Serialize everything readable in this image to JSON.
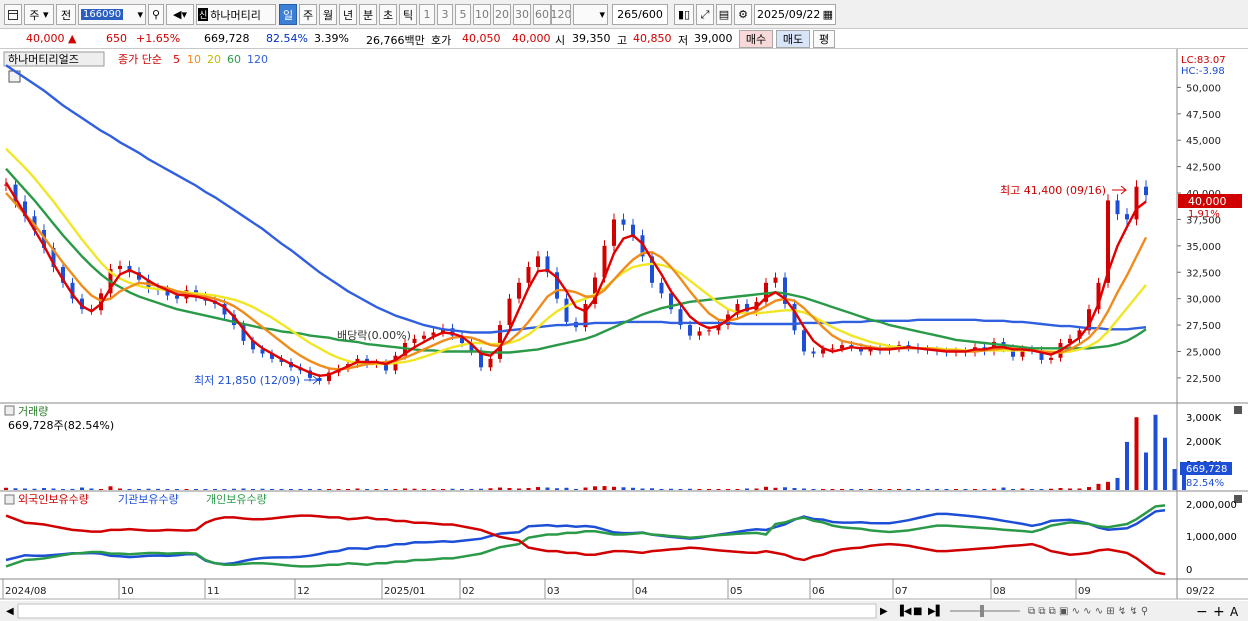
{
  "toolbar": {
    "period": "주",
    "prev": "전",
    "code": "166090",
    "stock_name": "하나머티리",
    "tf_day": "일",
    "tf_week": "주",
    "tf_month": "월",
    "tf_year": "년",
    "tf_minute": "분",
    "tf_second": "초",
    "tf_tick": "틱",
    "intervals": [
      "1",
      "3",
      "5",
      "10",
      "20",
      "30",
      "60",
      "120"
    ],
    "count": "265",
    "count_max": "/600",
    "date": "2025/09/22"
  },
  "quote": {
    "price": "40,000",
    "change": "650",
    "change_pct": "+1.65%",
    "volume": "669,728",
    "vol_ratio": "82.54%",
    "turnover": "3.39%",
    "amount": "26,766백만",
    "hoga_label": "호가",
    "ask": "40,050",
    "bid": "40,000",
    "open_label": "시",
    "open": "39,350",
    "high_label": "고",
    "high": "40,850",
    "low_label": "저",
    "low": "39,000",
    "buy": "매수",
    "sell": "매도",
    "avg": "평"
  },
  "legend": {
    "name": "하나머티리얼즈",
    "ma_label": "종가 단순",
    "periods": [
      "5",
      "10",
      "20",
      "60",
      "120"
    ]
  },
  "annotations": {
    "high": "최고 41,400 (09/16)",
    "low": "최저 21,850 (12/09)",
    "dividend": "배당락(0.00%)",
    "lc": "LC:83.07",
    "hc": "HC:-3.98",
    "cur_price": "40,000",
    "cur_pct": "1.91%"
  },
  "volume_panel": {
    "title": "거래량",
    "value_label": "669,728주(82.54%)",
    "cur": "669,728",
    "pct": "82.54%",
    "ticks": [
      "3,000K",
      "2,000K",
      "1,000K"
    ]
  },
  "holding_panel": {
    "foreign": "외국인보유수량",
    "institution": "기관보유수량",
    "individual": "개인보유수량",
    "ticks": [
      "2,000,000",
      "1,000,000",
      "0"
    ]
  },
  "colors": {
    "up": "#d00000",
    "down": "#1c4fd6",
    "ma5": "#e00000",
    "ma10": "#f08c1c",
    "ma20": "#f0e626",
    "ma60": "#2a9a48",
    "ma120": "#3060e0"
  },
  "chart_data": {
    "type": "candlestick",
    "x": [
      "2024/08",
      "10",
      "11",
      "12",
      "2025/01",
      "02",
      "03",
      "04",
      "05",
      "06",
      "07",
      "08",
      "09",
      "09/22"
    ],
    "y_ticks": [
      50000,
      47500,
      45000,
      42500,
      40000,
      37500,
      35000,
      32500,
      30000,
      27500,
      25000,
      22500
    ],
    "ylim": [
      20500,
      52500
    ],
    "close": [
      40800,
      39200,
      37800,
      36500,
      34800,
      33000,
      31500,
      30000,
      29000,
      28900,
      30500,
      32800,
      33100,
      32500,
      31800,
      31000,
      30800,
      30300,
      30000,
      30800,
      30200,
      29800,
      29500,
      28500,
      27500,
      26000,
      25200,
      24800,
      24300,
      24000,
      23500,
      23200,
      22500,
      22200,
      23000,
      23400,
      23800,
      24300,
      23800,
      23900,
      23200,
      24600,
      25800,
      26200,
      26500,
      26800,
      27200,
      26500,
      25800,
      25000,
      23500,
      24300,
      27500,
      30000,
      31500,
      33000,
      34000,
      32500,
      30000,
      27800,
      27300,
      29500,
      32000,
      35000,
      37500,
      37000,
      36000,
      34000,
      31500,
      30500,
      29000,
      27500,
      26500,
      26900,
      27000,
      27500,
      28500,
      29500,
      28800,
      29700,
      31500,
      32000,
      29500,
      27000,
      25000,
      24800,
      25200,
      25300,
      25600,
      25400,
      25000,
      25200,
      25100,
      25300,
      25600,
      25400,
      25200,
      25100,
      25000,
      24900,
      25000,
      24900,
      25400,
      25000,
      25900,
      25300,
      24500,
      25200,
      25100,
      24200,
      24400,
      25800,
      26200,
      27000,
      29000,
      31500,
      39300,
      38000,
      37500,
      40600,
      39800
    ],
    "ma5": [
      41000,
      39500,
      38000,
      36500,
      35000,
      33300,
      31800,
      30400,
      29300,
      28800,
      29500,
      31000,
      32300,
      32700,
      32300,
      31700,
      31200,
      30800,
      30400,
      30300,
      30200,
      30000,
      29700,
      29200,
      28300,
      27100,
      26000,
      25300,
      24800,
      24300,
      23800,
      23400,
      23000,
      22700,
      22800,
      23200,
      23600,
      24000,
      24000,
      24000,
      23800,
      24200,
      24800,
      25400,
      25900,
      26400,
      26800,
      26700,
      26400,
      25700,
      24800,
      24600,
      25400,
      27000,
      29000,
      31000,
      32600,
      32700,
      32000,
      30700,
      29200,
      28800,
      30000,
      32000,
      34300,
      35700,
      36000,
      35200,
      33700,
      32300,
      30700,
      29500,
      28300,
      27600,
      27200,
      27400,
      28000,
      28700,
      29000,
      29200,
      30100,
      30600,
      30000,
      28800,
      27300,
      26000,
      25300,
      25000,
      25200,
      25400,
      25300,
      25300,
      25200,
      25200,
      25300,
      25400,
      25300,
      25200,
      25100,
      25000,
      25000,
      25000,
      25200,
      25200,
      25400,
      25400,
      25200,
      25200,
      25100,
      24900,
      24700,
      25100,
      25700,
      26300,
      27500,
      29500,
      32500,
      35000,
      36800,
      38500,
      39200
    ],
    "ma10": [
      40000,
      39000,
      38000,
      37000,
      35800,
      34600,
      33400,
      32300,
      31200,
      30300,
      29800,
      30000,
      30700,
      31100,
      31500,
      31400,
      31200,
      31000,
      30700,
      30500,
      30300,
      30200,
      30000,
      29700,
      29300,
      28700,
      28000,
      27300,
      26600,
      25900,
      25200,
      24600,
      24100,
      23700,
      23400,
      23300,
      23400,
      23600,
      23800,
      23900,
      24000,
      24100,
      24400,
      24800,
      25200,
      25600,
      26000,
      26300,
      26400,
      26300,
      26000,
      25600,
      25500,
      26000,
      26800,
      27800,
      29000,
      30200,
      30800,
      30800,
      30600,
      30200,
      30200,
      30800,
      31800,
      32800,
      33700,
      34300,
      34400,
      33900,
      33000,
      31900,
      30700,
      29600,
      28600,
      28000,
      27900,
      28100,
      28500,
      28800,
      29300,
      29800,
      30000,
      29800,
      29100,
      28200,
      27300,
      26500,
      26000,
      25800,
      25600,
      25400,
      25300,
      25300,
      25300,
      25300,
      25300,
      25300,
      25200,
      25100,
      25100,
      25000,
      25000,
      25100,
      25200,
      25300,
      25300,
      25200,
      25100,
      25000,
      24900,
      24900,
      25200,
      25700,
      26300,
      27300,
      28800,
      30600,
      32200,
      34000,
      35800
    ],
    "ma20": [
      44200,
      43300,
      42400,
      41400,
      40300,
      39200,
      38000,
      36800,
      35600,
      34500,
      33400,
      32500,
      31900,
      31500,
      31200,
      31000,
      30900,
      30800,
      30700,
      30600,
      30500,
      30400,
      30300,
      30100,
      29900,
      29600,
      29200,
      28700,
      28200,
      27600,
      27000,
      26400,
      25800,
      25300,
      24800,
      24400,
      24100,
      23900,
      23800,
      23800,
      23800,
      23900,
      24000,
      24200,
      24500,
      24800,
      25100,
      25400,
      25600,
      25800,
      25800,
      25700,
      25700,
      25800,
      26100,
      26600,
      27300,
      28100,
      28800,
      29300,
      29700,
      30000,
      30400,
      31000,
      31800,
      32500,
      33000,
      33200,
      33300,
      33200,
      32900,
      32400,
      31700,
      31000,
      30300,
      29600,
      29000,
      28700,
      28600,
      28600,
      28700,
      28800,
      28900,
      28900,
      28700,
      28300,
      27800,
      27300,
      26900,
      26500,
      26200,
      25900,
      25700,
      25500,
      25400,
      25400,
      25300,
      25300,
      25300,
      25200,
      25200,
      25100,
      25100,
      25100,
      25100,
      25100,
      25100,
      25100,
      25100,
      25000,
      25000,
      24900,
      25000,
      25200,
      25500,
      26000,
      26900,
      28000,
      29100,
      30200,
      31300
    ],
    "ma60": [
      42300,
      41300,
      40300,
      39300,
      38200,
      37100,
      36000,
      35000,
      34000,
      33100,
      32300,
      31600,
      31100,
      30600,
      30200,
      29900,
      29600,
      29300,
      29000,
      28800,
      28600,
      28400,
      28200,
      28000,
      27800,
      27600,
      27400,
      27200,
      27100,
      26900,
      26800,
      26700,
      26500,
      26400,
      26300,
      26100,
      26000,
      25900,
      25700,
      25600,
      25500,
      25400,
      25300,
      25200,
      25100,
      25100,
      25000,
      25000,
      25000,
      25000,
      25000,
      24900,
      24900,
      24900,
      25000,
      25100,
      25200,
      25400,
      25600,
      25800,
      26000,
      26200,
      26500,
      26900,
      27300,
      27700,
      28100,
      28500,
      28800,
      29100,
      29300,
      29500,
      29700,
      29800,
      29900,
      30000,
      30100,
      30200,
      30300,
      30400,
      30500,
      30600,
      30500,
      30300,
      30100,
      29800,
      29500,
      29200,
      28900,
      28600,
      28300,
      28000,
      27800,
      27500,
      27300,
      27100,
      26900,
      26700,
      26500,
      26300,
      26100,
      26000,
      25900,
      25800,
      25700,
      25600,
      25500,
      25400,
      25300,
      25300,
      25300,
      25300,
      25300,
      25300,
      25300,
      25400,
      25500,
      25700,
      26000,
      26500,
      27100
    ],
    "ma120": [
      52100,
      51500,
      50900,
      50300,
      49700,
      49000,
      48300,
      47700,
      47100,
      46500,
      45900,
      45400,
      44800,
      44300,
      43800,
      43200,
      42700,
      42200,
      41700,
      41200,
      40700,
      40100,
      39600,
      39000,
      38400,
      37800,
      37200,
      36600,
      35900,
      35200,
      34600,
      33900,
      33200,
      32500,
      31900,
      31300,
      30700,
      30200,
      29700,
      29200,
      28800,
      28400,
      28100,
      27800,
      27500,
      27300,
      27100,
      27000,
      26900,
      26800,
      26800,
      26800,
      26900,
      27000,
      27100,
      27200,
      27300,
      27400,
      27500,
      27500,
      27600,
      27600,
      27700,
      27700,
      27700,
      27800,
      27800,
      27800,
      27800,
      27800,
      27700,
      27700,
      27700,
      27700,
      27700,
      27700,
      27700,
      27600,
      27600,
      27600,
      27600,
      27600,
      27600,
      27600,
      27700,
      27700,
      27700,
      27700,
      27800,
      27800,
      27800,
      27900,
      27900,
      27900,
      27900,
      27900,
      28000,
      28000,
      28000,
      28000,
      28000,
      28000,
      28000,
      27900,
      27900,
      27900,
      27800,
      27800,
      27700,
      27600,
      27500,
      27400,
      27400,
      27300,
      27200,
      27200,
      27100,
      27100,
      27100,
      27200,
      27300
    ],
    "volume_k": [
      90,
      70,
      60,
      50,
      80,
      60,
      40,
      45,
      100,
      60,
      30,
      150,
      60,
      40,
      40,
      50,
      45,
      40,
      30,
      30,
      40,
      30,
      40,
      30,
      50,
      60,
      40,
      50,
      40,
      40,
      30,
      30,
      30,
      30,
      40,
      30,
      40,
      60,
      40,
      30,
      30,
      40,
      60,
      50,
      40,
      40,
      40,
      50,
      40,
      30,
      50,
      70,
      100,
      80,
      60,
      80,
      120,
      100,
      70,
      90,
      40,
      100,
      150,
      160,
      130,
      110,
      90,
      60,
      70,
      40,
      50,
      30,
      50,
      30,
      30,
      30,
      40,
      40,
      60,
      60,
      130,
      90,
      110,
      80,
      60,
      40,
      30,
      30,
      40,
      30,
      40,
      30,
      30,
      30,
      40,
      20,
      30,
      30,
      30,
      20,
      30,
      30,
      40,
      30,
      50,
      100,
      40,
      60,
      30,
      40,
      50,
      80,
      60,
      60,
      120,
      250,
      330,
      490,
      1950,
      2950,
      1520,
      3050,
      2120,
      850,
      669
    ],
    "foreign": [
      1700000,
      1600000,
      1500000,
      1480000,
      1450000,
      1400000,
      1350000,
      1300000,
      1280000,
      1250000,
      1250000,
      1300000,
      1300000,
      1320000,
      1300000,
      1280000,
      1280000,
      1300000,
      1290000,
      1280000,
      1300000,
      1500000,
      1600000,
      1650000,
      1650000,
      1620000,
      1600000,
      1600000,
      1620000,
      1650000,
      1680000,
      1700000,
      1700000,
      1680000,
      1650000,
      1650000,
      1600000,
      1620000,
      1650000,
      1600000,
      1600000,
      1550000,
      1550000,
      1500000,
      1500000,
      1480000,
      1450000,
      1450000,
      1400000,
      1350000,
      1300000,
      1200000,
      1100000,
      1050000,
      1000000,
      800000,
      750000,
      700000,
      700000,
      650000,
      650000,
      600000,
      600000,
      650000,
      700000,
      700000,
      680000,
      650000,
      700000,
      720000,
      750000,
      770000,
      800000,
      780000,
      750000,
      720000,
      700000,
      680000,
      660000,
      650000,
      700000,
      650000,
      600000,
      500000,
      450000,
      550000,
      600000,
      700000,
      750000,
      780000,
      800000,
      850000,
      880000,
      900000,
      880000,
      850000,
      800000,
      750000,
      700000,
      700000,
      720000,
      740000,
      760000,
      780000,
      800000,
      830000,
      850000,
      870000,
      900000,
      820000,
      700000,
      650000,
      600000,
      620000,
      650000,
      720000,
      750000,
      700000,
      650000,
      500000,
      300000,
      100000,
      50000
    ]
  }
}
